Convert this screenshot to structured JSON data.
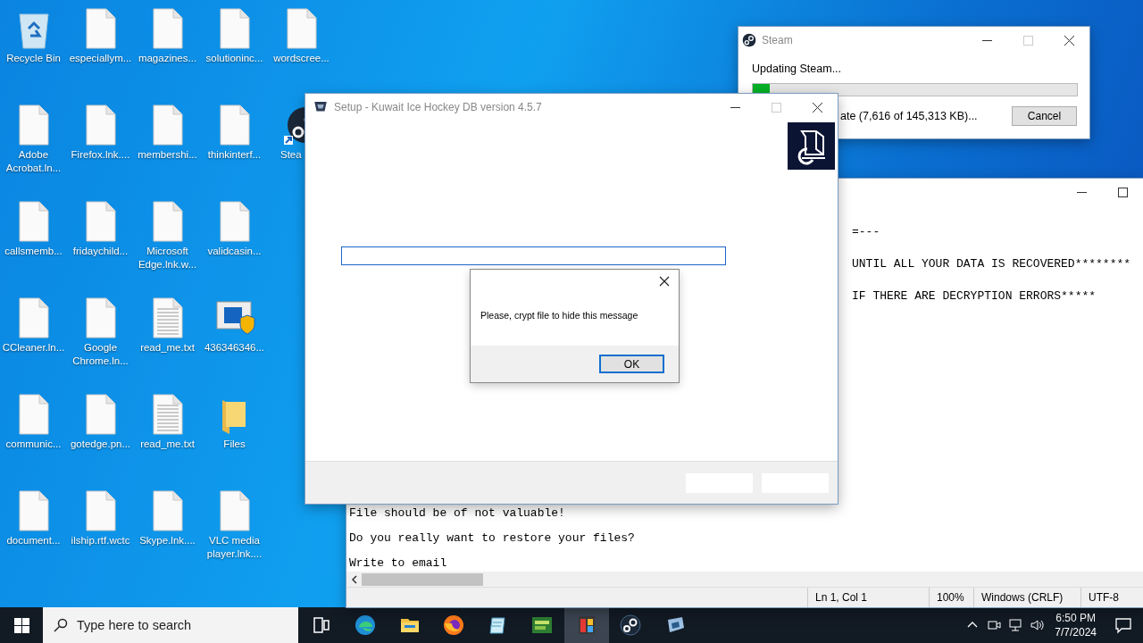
{
  "desktop_icons": [
    {
      "icons": [
        {
          "kind": "recycle",
          "label": "Recycle Bin"
        },
        {
          "kind": "file",
          "label": "especiallym..."
        },
        {
          "kind": "file",
          "label": "magazines..."
        },
        {
          "kind": "file",
          "label": "solutioninc..."
        },
        {
          "kind": "file",
          "label": "wordscree..."
        }
      ]
    },
    {
      "icons": [
        {
          "kind": "file",
          "label": "Adobe Acrobat.ln..."
        },
        {
          "kind": "file",
          "label": "Firefox.lnk...."
        },
        {
          "kind": "file",
          "label": "membershi..."
        },
        {
          "kind": "file",
          "label": "thinkinterf..."
        },
        {
          "kind": "steam",
          "label": "Stea"
        }
      ]
    },
    {
      "icons": [
        {
          "kind": "file",
          "label": "callsmemb..."
        },
        {
          "kind": "file",
          "label": "fridaychild..."
        },
        {
          "kind": "file",
          "label": "Microsoft Edge.lnk.w..."
        },
        {
          "kind": "file",
          "label": "validcasin..."
        }
      ]
    },
    {
      "icons": [
        {
          "kind": "file",
          "label": "CCleaner.ln..."
        },
        {
          "kind": "file",
          "label": "Google Chrome.ln..."
        },
        {
          "kind": "text",
          "label": "read_me.txt"
        },
        {
          "kind": "installer",
          "label": "436346346..."
        }
      ]
    },
    {
      "icons": [
        {
          "kind": "file",
          "label": "communic..."
        },
        {
          "kind": "file",
          "label": "gotedge.pn..."
        },
        {
          "kind": "text",
          "label": "read_me.txt"
        },
        {
          "kind": "folder",
          "label": "Files"
        }
      ]
    },
    {
      "icons": [
        {
          "kind": "file",
          "label": "document..."
        },
        {
          "kind": "file",
          "label": "ilship.rtf.wctc"
        },
        {
          "kind": "file",
          "label": "Skype.lnk...."
        },
        {
          "kind": "file",
          "label": "VLC media player.lnk...."
        }
      ]
    }
  ],
  "notepad": {
    "top_lines": [
      "=---",
      "UNTIL ALL YOUR DATA IS RECOVERED********",
      "IF THERE ARE DECRYPTION ERRORS*****"
    ],
    "bottom_lines": [
      "File should be of not valuable!",
      "Do you really want to restore your files?",
      "Write to email"
    ],
    "status": [
      "Ln 1, Col 1",
      "100%",
      "Windows (CRLF)",
      "UTF-8"
    ]
  },
  "steam": {
    "title": "Steam",
    "heading": "Updating Steam...",
    "progress": {
      "level": 0.052
    },
    "detail": "ate (7,616 of 145,313 KB)...",
    "cancel": "Cancel"
  },
  "setup": {
    "title": "Setup - Kuwait Ice Hockey DB version 4.5.7"
  },
  "message_box": {
    "text": "Please, crypt file to hide this message",
    "ok": "OK"
  },
  "taskbar": {
    "search_placeholder": "Type here to search",
    "apps": [
      {
        "kind": "taskview",
        "selected": false
      },
      {
        "kind": "edge",
        "selected": false
      },
      {
        "kind": "explorer",
        "selected": false
      },
      {
        "kind": "firefox",
        "selected": false
      },
      {
        "kind": "notepad",
        "selected": false
      },
      {
        "kind": "game",
        "selected": false
      },
      {
        "kind": "setup",
        "selected": true
      },
      {
        "kind": "steam",
        "selected": false
      },
      {
        "kind": "installer",
        "selected": false
      }
    ],
    "time": "6:50 PM",
    "date": "7/7/2024"
  }
}
